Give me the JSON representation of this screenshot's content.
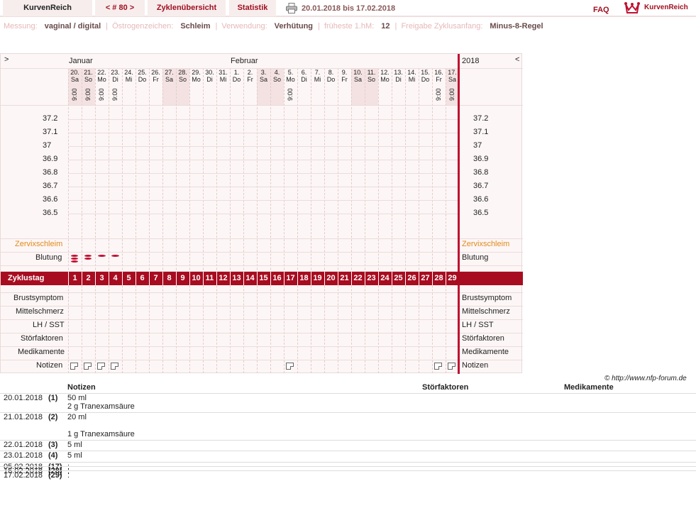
{
  "header": {
    "brand": "KurvenReich",
    "cycle_nav": "< # 80 >",
    "tab_overview": "Zyklenübersicht",
    "tab_stats": "Statistik",
    "date_range": "20.01.2018 bis 17.02.2018",
    "faq": "FAQ",
    "logo_text": "KurvenReich"
  },
  "meta": [
    {
      "label": "Messung:",
      "value": "vaginal / digital"
    },
    {
      "label": "Östrogenzeichen:",
      "value": "Schleim"
    },
    {
      "label": "Verwendung:",
      "value": "Verhütung"
    },
    {
      "label": "früheste 1.hM:",
      "value": "12"
    },
    {
      "label": "Freigabe Zyklusanfang:",
      "value": "Minus-8-Regel"
    }
  ],
  "chart": {
    "nav_prev": ">",
    "nav_next": "<",
    "month1": "Januar",
    "month2": "Februar",
    "year": "2018",
    "days": [
      {
        "d": "20.",
        "w": "Sa",
        "t": "9:00",
        "we": true
      },
      {
        "d": "21.",
        "w": "So",
        "t": "9:00",
        "we": true
      },
      {
        "d": "22.",
        "w": "Mo",
        "t": "9:00"
      },
      {
        "d": "23.",
        "w": "Di",
        "t": "9:00"
      },
      {
        "d": "24.",
        "w": "Mi",
        "t": ""
      },
      {
        "d": "25.",
        "w": "Do",
        "t": ""
      },
      {
        "d": "26.",
        "w": "Fr",
        "t": ""
      },
      {
        "d": "27.",
        "w": "Sa",
        "t": "",
        "we": true
      },
      {
        "d": "28.",
        "w": "So",
        "t": "",
        "we": true
      },
      {
        "d": "29.",
        "w": "Mo",
        "t": ""
      },
      {
        "d": "30.",
        "w": "Di",
        "t": ""
      },
      {
        "d": "31.",
        "w": "Mi",
        "t": ""
      },
      {
        "d": "1.",
        "w": "Do",
        "t": ""
      },
      {
        "d": "2.",
        "w": "Fr",
        "t": ""
      },
      {
        "d": "3.",
        "w": "Sa",
        "t": "",
        "we": true
      },
      {
        "d": "4.",
        "w": "So",
        "t": "",
        "we": true
      },
      {
        "d": "5.",
        "w": "Mo",
        "t": "9:00"
      },
      {
        "d": "6.",
        "w": "Di",
        "t": ""
      },
      {
        "d": "7.",
        "w": "Mi",
        "t": ""
      },
      {
        "d": "8.",
        "w": "Do",
        "t": ""
      },
      {
        "d": "9.",
        "w": "Fr",
        "t": ""
      },
      {
        "d": "10.",
        "w": "Sa",
        "t": "",
        "we": true
      },
      {
        "d": "11.",
        "w": "So",
        "t": "",
        "we": true
      },
      {
        "d": "12.",
        "w": "Mo",
        "t": ""
      },
      {
        "d": "13.",
        "w": "Di",
        "t": ""
      },
      {
        "d": "14.",
        "w": "Mi",
        "t": ""
      },
      {
        "d": "15.",
        "w": "Do",
        "t": ""
      },
      {
        "d": "16.",
        "w": "Fr",
        "t": "9:00"
      },
      {
        "d": "17.",
        "w": "Sa",
        "t": "9:00",
        "we": true
      }
    ],
    "temps": [
      "37.2",
      "37.1",
      "37",
      "36.9",
      "36.8",
      "36.7",
      "36.6",
      "36.5"
    ],
    "rows": {
      "zervix": "Zervixschleim",
      "blutung": "Blutung",
      "zyklustag": "Zyklustag",
      "brust": "Brustsymptom",
      "mittel": "Mittelschmerz",
      "lh": "LH / SST",
      "stoer": "Störfaktoren",
      "medi": "Medikamente",
      "notizen": "Notizen"
    },
    "bleeding": [
      3,
      2,
      1,
      1
    ],
    "note_days": [
      1,
      2,
      3,
      4,
      17,
      28,
      29
    ]
  },
  "copyright": "© http://www.nfp-forum.de",
  "notes_table": {
    "headers": [
      "Notizen",
      "Störfaktoren",
      "Medikamente"
    ],
    "rows": [
      {
        "date": "20.01.2018",
        "num": "(1)",
        "text": [
          "50 ml",
          "2 g Tranexamsäure"
        ]
      },
      {
        "date": "21.01.2018",
        "num": "(2)",
        "text": [
          "20 ml",
          "",
          "1 g Tranexamsäure"
        ]
      },
      {
        "date": "22.01.2018",
        "num": "(3)",
        "text": [
          "5 ml"
        ]
      },
      {
        "date": "23.01.2018",
        "num": "(4)",
        "text": [
          "5 ml"
        ]
      },
      {
        "date": "05.02.2018",
        "num": "(17)",
        "text": [
          ":"
        ]
      },
      {
        "date": "16.02.2018",
        "num": "(28)",
        "text": [
          ":"
        ]
      },
      {
        "date": "17.02.2018",
        "num": "(29)",
        "text": [
          ":"
        ]
      }
    ]
  }
}
